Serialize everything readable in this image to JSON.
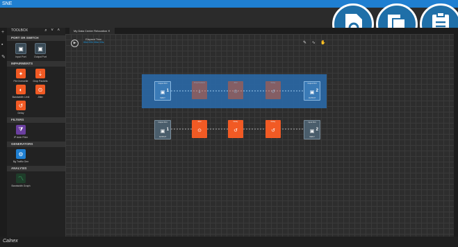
{
  "app": {
    "title": "SNE",
    "brand": "Calnex"
  },
  "top_icons": [
    {
      "name": "document-search-icon"
    },
    {
      "name": "copy-icon"
    },
    {
      "name": "clipboard-icon"
    }
  ],
  "toolbox": {
    "title": "TOOLBOX",
    "sections": [
      {
        "title": "PORT OR SWITCH",
        "items": [
          {
            "label": "Input Port",
            "icon": "port-icon"
          },
          {
            "label": "Output Port",
            "icon": "port-icon"
          }
        ]
      },
      {
        "title": "IMPAIRMENTS",
        "items": [
          {
            "label": "Pkt Overwrite",
            "icon": "overwrite-icon"
          },
          {
            "label": "Drop Packets",
            "icon": "drop-icon"
          },
          {
            "label": "Bandwidth Limit",
            "icon": "bandwidth-icon"
          },
          {
            "label": "Jitter",
            "icon": "jitter-icon"
          },
          {
            "label": "Delay",
            "icon": "delay-icon"
          }
        ]
      },
      {
        "title": "FILTERS",
        "items": [
          {
            "label": "IP Addr Filter",
            "icon": "filter-icon"
          }
        ]
      },
      {
        "title": "GENERATORS",
        "items": [
          {
            "label": "Bg Traffic Gen",
            "icon": "generator-icon"
          }
        ]
      },
      {
        "title": "ANALYSIS",
        "items": [
          {
            "label": "Bandwidth Graph",
            "icon": "graph-icon"
          }
        ]
      }
    ]
  },
  "tab": {
    "label": "My Data Center Relocation"
  },
  "elapsed": {
    "label": "Elapsed Time",
    "value": "00d 00h 00m 00s"
  },
  "pipeline_top": [
    {
      "header": "Output Port",
      "footer": "INPUT",
      "num": "1",
      "type": "port"
    },
    {
      "header": "Drop Packets",
      "type": "imp"
    },
    {
      "header": "Jitter",
      "type": "imp"
    },
    {
      "header": "Delay",
      "type": "imp"
    },
    {
      "header": "Output Port",
      "footer": "OUTPUT",
      "num": "2",
      "type": "port"
    }
  ],
  "pipeline_bottom": [
    {
      "header": "Output Port",
      "footer": "OUTPUT",
      "num": "1",
      "type": "port"
    },
    {
      "header": "Jitter",
      "type": "imp"
    },
    {
      "header": "Delay",
      "type": "imp"
    },
    {
      "header": "Delay",
      "type": "imp"
    },
    {
      "header": "Input Port",
      "footer": "INPUT",
      "num": "2",
      "type": "port"
    }
  ]
}
